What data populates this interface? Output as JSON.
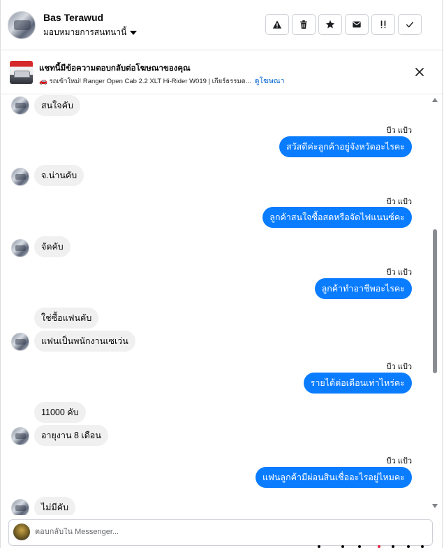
{
  "header": {
    "user_name": "Bas Terawud",
    "assign_label": "มอบหมายการสนทนานี้",
    "actions": [
      {
        "icon": "warning-icon"
      },
      {
        "icon": "trash-icon"
      },
      {
        "icon": "star-icon"
      },
      {
        "icon": "mail-icon"
      },
      {
        "icon": "follow-up-icon"
      },
      {
        "icon": "check-icon"
      }
    ]
  },
  "banner": {
    "title": "แชทนี้มีข้อความตอบกลับต่อโฆษณาของคุณ",
    "subtitle": "🚗 รถเข้าใหม่! Ranger Open Cab 2.2 XLT Hi-Rider W019 | เกียร์ธรรมด...",
    "link": "ดูโฆษณา"
  },
  "messages": [
    {
      "dir": "in",
      "text": "สนใจคับ",
      "avatar": true
    },
    {
      "dir": "out",
      "seen": "บีว แป้ว",
      "text": "สวัสดีค่ะลูกค้าอยู่จังหวัดอะไรคะ"
    },
    {
      "dir": "in",
      "text": "จ.น่านคับ",
      "avatar": true
    },
    {
      "dir": "out",
      "seen": "บีว แป้ว",
      "text": "ลูกค้าสนใจซื้อสดหรือจัดไฟแนนซ์คะ"
    },
    {
      "dir": "in",
      "text": "จัดคับ",
      "avatar": true
    },
    {
      "dir": "out",
      "seen": "บีว แป้ว",
      "text": "ลูกค้าทำอาชีพอะไรคะ"
    },
    {
      "dir": "in",
      "text": "ใช่ซื้อแฟนคับ",
      "avatar": false
    },
    {
      "dir": "in",
      "text": "แฟนเป็นพนักงานเซเว่น",
      "avatar": true
    },
    {
      "dir": "out",
      "seen": "บีว แป้ว",
      "text": "รายได้ต่อเดือนเท่าไหร่คะ"
    },
    {
      "dir": "in",
      "text": "11000 คับ",
      "avatar": false
    },
    {
      "dir": "in",
      "text": "อายุงาน 8 เดือน",
      "avatar": true
    },
    {
      "dir": "out",
      "seen": "บีว แป้ว",
      "text": "แฟนลูกค้ามีผ่อนสินเชื่ออะไรอยู่ไหมคะ"
    },
    {
      "dir": "in",
      "text": "ไม่มีคับ",
      "avatar": true
    }
  ],
  "composer": {
    "placeholder": "ตอบกลับใน Messenger..."
  },
  "colors": {
    "outgoing_bubble": "#0a7cff",
    "incoming_bubble": "#f0f0f0",
    "link": "#0064d1"
  }
}
